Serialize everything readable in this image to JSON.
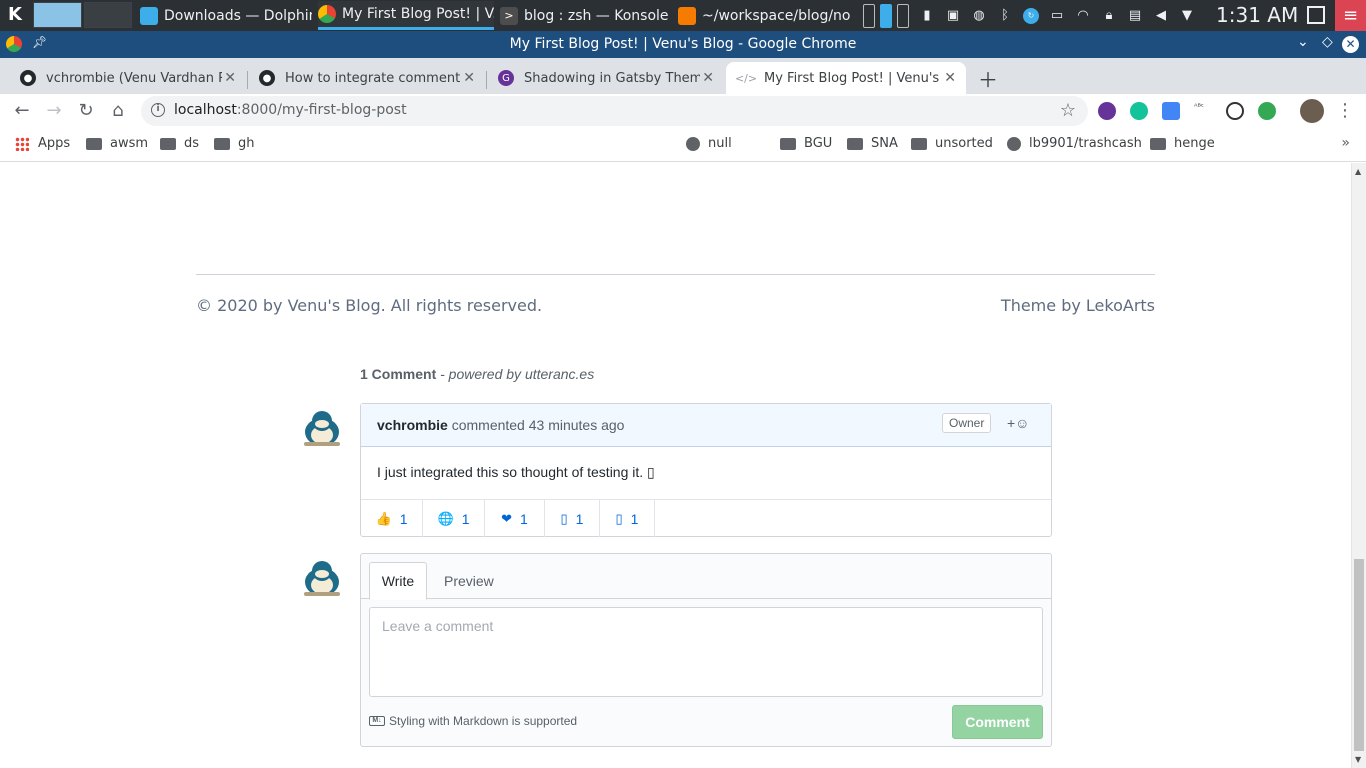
{
  "taskbar": {
    "tasks": [
      {
        "label": "Downloads — Dolphin",
        "color": "#3daee9"
      },
      {
        "label": "My First Blog Post! | V...",
        "color": "#fbbc05"
      },
      {
        "label": "blog : zsh — Konsole",
        "color": "#4d4d4d"
      },
      {
        "label": "~/workspace/blog/no...",
        "color": "#f57c00"
      }
    ],
    "clock": "1:31 AM",
    "tray_icons": [
      "usb-icon",
      "screenshot-icon",
      "vpn-icon",
      "bluetooth-icon",
      "update-icon",
      "battery-icon",
      "wifi-icon",
      "lock-icon",
      "clipboard-icon",
      "volume-icon",
      "expand-icon",
      "desktop-icon"
    ]
  },
  "window": {
    "title": "My First Blog Post! | Venu's Blog - Google Chrome"
  },
  "tabs": [
    {
      "label": "vchrombie (Venu Vardhan Re",
      "color": "#24292e"
    },
    {
      "label": "How to integrate comment sy",
      "color": "#24292e"
    },
    {
      "label": "Shadowing in Gatsby Themes",
      "color": "#663399"
    },
    {
      "label": "My First Blog Post! | Venu's B",
      "color": "#9aa0a6"
    }
  ],
  "omnibox": {
    "host": "localhost",
    "path": ":8000/my-first-blog-post"
  },
  "bookmarks": [
    {
      "label": "Apps",
      "kind": "apps"
    },
    {
      "label": "awsm",
      "kind": "folder"
    },
    {
      "label": "ds",
      "kind": "folder"
    },
    {
      "label": "gh",
      "kind": "folder"
    },
    {
      "label": "null",
      "kind": "globe"
    },
    {
      "label": "BGU",
      "kind": "folder"
    },
    {
      "label": "SNA",
      "kind": "folder"
    },
    {
      "label": "unsorted",
      "kind": "folder"
    },
    {
      "label": "lb9901/trashcash",
      "kind": "globe"
    },
    {
      "label": "henge",
      "kind": "folder"
    }
  ],
  "footer": {
    "copyright": "© 2020 by Venu's Blog. All rights reserved.",
    "theme": "Theme by LekoArts"
  },
  "comments": {
    "count_label": "1 Comment",
    "powered": " - powered by utteranc.es",
    "items": [
      {
        "author": "vchrombie",
        "meta": " commented 43 minutes ago",
        "badge": "Owner",
        "add_reaction": "+☺",
        "body": "I just integrated this so thought of testing it. ▯",
        "reactions": [
          {
            "emoji": "👍",
            "count": "1"
          },
          {
            "emoji": "🌐",
            "count": "1"
          },
          {
            "emoji": "❤",
            "count": "1"
          },
          {
            "emoji": "▯",
            "count": "1"
          },
          {
            "emoji": "▯",
            "count": "1"
          }
        ]
      }
    ],
    "editor": {
      "tab_write": "Write",
      "tab_preview": "Preview",
      "placeholder": "Leave a comment",
      "markdown_note": "Styling with Markdown is supported",
      "submit": "Comment"
    }
  }
}
